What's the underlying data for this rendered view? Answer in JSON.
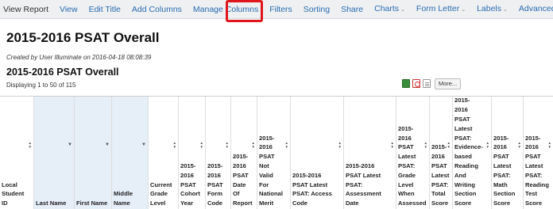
{
  "nav": {
    "items": [
      {
        "label": "View Report",
        "dropdown": false
      },
      {
        "label": "View",
        "dropdown": false
      },
      {
        "label": "Edit Title",
        "dropdown": false
      },
      {
        "label": "Add Columns",
        "dropdown": false
      },
      {
        "label": "Manage Columns",
        "dropdown": false
      },
      {
        "label": "Filters",
        "dropdown": false
      },
      {
        "label": "Sorting",
        "dropdown": false
      },
      {
        "label": "Share",
        "dropdown": false
      },
      {
        "label": "Charts",
        "dropdown": true
      },
      {
        "label": "Form Letter",
        "dropdown": true
      },
      {
        "label": "Labels",
        "dropdown": true
      },
      {
        "label": "Advanced",
        "dropdown": true
      }
    ],
    "highlighted": "Filters"
  },
  "page": {
    "title": "2015-2016 PSAT Overall",
    "created": "Created by User Illuminate on 2016-04-18 08:08:39",
    "subtitle": "2015-2016 PSAT Overall",
    "displaying": "Displaying 1 to 50 of 115",
    "more_button": "More...",
    "icons": [
      "excel-icon",
      "pdf-icon",
      "document-icon"
    ]
  },
  "columns": [
    {
      "lines": [
        "Local",
        "Student",
        "ID"
      ],
      "icon": "sort-icon",
      "highlighted": false
    },
    {
      "lines": [
        "Last Name"
      ],
      "icon": "caret-down-icon",
      "highlighted": true
    },
    {
      "lines": [
        "First Name"
      ],
      "icon": "caret-down-icon",
      "highlighted": true
    },
    {
      "lines": [
        "Middle",
        "Name"
      ],
      "icon": "caret-down-icon",
      "highlighted": true
    },
    {
      "lines": [
        "Current",
        "Grade",
        "Level"
      ],
      "icon": "sort-icon",
      "highlighted": false
    },
    {
      "lines": [
        "2015-",
        "2016",
        "PSAT",
        "Cohort",
        "Year"
      ],
      "icon": "sort-icon",
      "highlighted": false
    },
    {
      "lines": [
        "2015-",
        "2016",
        "PSAT",
        "Form",
        "Code"
      ],
      "icon": "sort-icon",
      "highlighted": false
    },
    {
      "lines": [
        "2015-",
        "2016",
        "PSAT",
        "Date",
        "Of",
        "Report"
      ],
      "icon": "sort-icon",
      "highlighted": false
    },
    {
      "lines": [
        "2015-",
        "2016",
        "PSAT",
        "Not",
        "Valid",
        "For",
        "National",
        "Merit"
      ],
      "icon": "sort-icon",
      "highlighted": false
    },
    {
      "lines": [
        "2015-2016",
        "PSAT Latest",
        "PSAT: Access",
        "Code"
      ],
      "icon": "sort-icon",
      "highlighted": false
    },
    {
      "lines": [
        "2015-2016",
        "PSAT Latest",
        "PSAT:",
        "Assessment",
        "Date"
      ],
      "icon": "sort-icon",
      "highlighted": false
    },
    {
      "lines": [
        "2015-",
        "2016",
        "PSAT",
        "Latest",
        "PSAT:",
        "Grade",
        "Level",
        "When",
        "Assessed"
      ],
      "icon": "sort-icon",
      "highlighted": false
    },
    {
      "lines": [
        "2015-",
        "2016",
        "PSAT",
        "Latest",
        "PSAT:",
        "Total",
        "Score"
      ],
      "icon": "sort-icon",
      "highlighted": false
    },
    {
      "lines": [
        "2015-",
        "2016",
        "PSAT",
        "Latest",
        "PSAT:",
        "Evidence-",
        "based",
        "Reading",
        "And",
        "Writing",
        "Section",
        "Score"
      ],
      "icon": "sort-icon",
      "highlighted": false
    },
    {
      "lines": [
        "2015-",
        "2016",
        "PSAT",
        "Latest",
        "PSAT:",
        "Math",
        "Section",
        "Score"
      ],
      "icon": "sort-icon",
      "highlighted": false
    },
    {
      "lines": [
        "2015-",
        "2016",
        "PSAT",
        "Latest",
        "PSAT:",
        "Reading",
        "Test",
        "Score"
      ],
      "icon": "sort-icon",
      "highlighted": false
    }
  ]
}
